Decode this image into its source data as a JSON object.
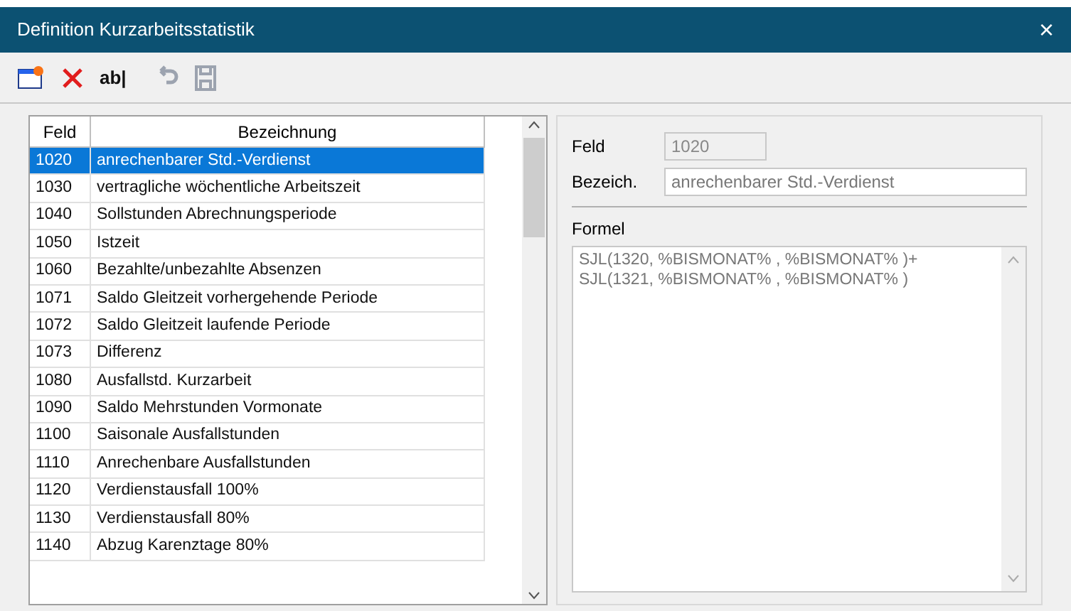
{
  "window": {
    "title": "Definition Kurzarbeitsstatistik",
    "close": "×"
  },
  "toolbar": [
    {
      "kind": "new",
      "disabled": false
    },
    {
      "kind": "delete",
      "disabled": false
    },
    {
      "kind": "rename",
      "label": "ab|",
      "disabled": false
    },
    {
      "kind": "undo",
      "disabled": true
    },
    {
      "kind": "save",
      "disabled": true
    }
  ],
  "table": {
    "columns": [
      "Feld",
      "Bezeichnung"
    ],
    "rows": [
      {
        "feld": "1020",
        "bezeichnung": "anrechenbarer Std.-Verdienst",
        "selected": true
      },
      {
        "feld": "1030",
        "bezeichnung": "vertragliche wöchentliche Arbeitszeit",
        "selected": false
      },
      {
        "feld": "1040",
        "bezeichnung": "Sollstunden Abrechnungsperiode",
        "selected": false
      },
      {
        "feld": "1050",
        "bezeichnung": "Istzeit",
        "selected": false
      },
      {
        "feld": "1060",
        "bezeichnung": "Bezahlte/unbezahlte Absenzen",
        "selected": false
      },
      {
        "feld": "1071",
        "bezeichnung": "Saldo Gleitzeit vorhergehende Periode",
        "selected": false
      },
      {
        "feld": "1072",
        "bezeichnung": "Saldo Gleitzeit laufende Periode",
        "selected": false
      },
      {
        "feld": "1073",
        "bezeichnung": "Differenz",
        "selected": false
      },
      {
        "feld": "1080",
        "bezeichnung": "Ausfallstd. Kurzarbeit",
        "selected": false
      },
      {
        "feld": "1090",
        "bezeichnung": "Saldo Mehrstunden Vormonate",
        "selected": false
      },
      {
        "feld": "1100",
        "bezeichnung": "Saisonale Ausfallstunden",
        "selected": false
      },
      {
        "feld": "1110",
        "bezeichnung": "Anrechenbare Ausfallstunden",
        "selected": false
      },
      {
        "feld": "1120",
        "bezeichnung": "Verdienstausfall 100%",
        "selected": false
      },
      {
        "feld": "1130",
        "bezeichnung": "Verdienstausfall 80%",
        "selected": false
      },
      {
        "feld": "1140",
        "bezeichnung": "Abzug Karenztage 80%",
        "selected": false
      }
    ]
  },
  "detail": {
    "feld_label": "Feld",
    "feld_value": "1020",
    "feld_disabled": true,
    "bezeich_label": "Bezeich.",
    "bezeich_value": "anrechenbarer Std.-Verdienst",
    "formel_label": "Formel",
    "formel_value": "SJL(1320, %BISMONAT% , %BISMONAT% )+ SJL(1321, %BISMONAT% , %BISMONAT% )"
  }
}
